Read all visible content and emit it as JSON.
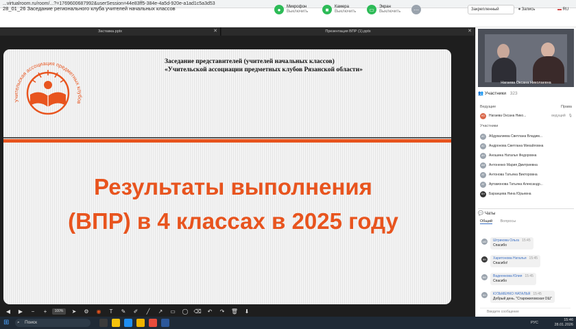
{
  "browser": {
    "url": "...virtualroom.ru/room/...?=1769600687992&userSession=44e83ff5-384e-4a5d-920e-a1ad1c5a3d53"
  },
  "meeting": {
    "title": "28_01_26 Заседание регионального клуба учителей начальных классов"
  },
  "controls": [
    {
      "label": "Микрофон",
      "sub": "Выключить"
    },
    {
      "label": "Камера",
      "sub": "Выключить"
    },
    {
      "label": "Экран",
      "sub": "Выключить"
    }
  ],
  "top_right": {
    "language_select": "Закрепленный",
    "record": "Запись",
    "lang": "RU"
  },
  "stage_tabs": [
    {
      "label": "Заставка.pptx"
    },
    {
      "label": "Презентация ВПР (1).pptx"
    }
  ],
  "slide": {
    "header_line1": "Заседание представителей (учителей начальных классов)",
    "header_line2": "«Учительской ассоциации предметных клубов Рязанской области»",
    "title_line1": "Результаты выполнения",
    "title_line2": "(ВПР) в 4 классах в 2025 году",
    "logo_arc_text": "Учительская ассоциация предметных клубов Рязанской области"
  },
  "toolbar": {
    "zoom": "100%"
  },
  "taskbar": {
    "search_placeholder": "Поиск",
    "lang": "РУС",
    "time": "15:46",
    "date": "28.01.2026"
  },
  "video": {
    "name": "Нагаева Оксана Николаевна"
  },
  "participants": {
    "title": "Участники",
    "count": "323",
    "leaders_label": "Ведущие",
    "rights_label": "Права",
    "leader": {
      "initials": "НО",
      "name": "Нагаева Оксана Нико...",
      "role": "ведущий"
    },
    "members_label": "Участники",
    "members": [
      {
        "initials": "АС",
        "name": "Абдувалиева Светлана Владим..."
      },
      {
        "initials": "АС",
        "name": "Андронова Светлана Михайловна"
      },
      {
        "initials": "АН",
        "name": "Аношина Наталья Федоровна"
      },
      {
        "initials": "АМ",
        "name": "Антоненко Мария Дмитриевна"
      },
      {
        "initials": "АТ",
        "name": "Антонова Татьяна Викторовна"
      },
      {
        "initials": "АТ",
        "name": "Артамонова Татьяна Александр..."
      },
      {
        "initials": "БН",
        "name": "Баранцева Нина Юрьевна"
      }
    ]
  },
  "chat": {
    "title": "Чаты",
    "tabs": [
      "Общий",
      "Вопросы"
    ],
    "messages": [
      {
        "initials": "ШО",
        "author": "Штрикова Ольга",
        "time": "15:45",
        "text": "Спасибо"
      },
      {
        "initials": "КН",
        "author": "Харитонова Наталья",
        "time": "15:45",
        "text": "Спасибо!"
      },
      {
        "initials": "ВЮ",
        "author": "Вадеенкова Юлия",
        "time": "15:45",
        "text": "Спасибо"
      },
      {
        "initials": "КН",
        "author": "КУЗЬМЕНКО НАТАЛЬЯ",
        "time": "15:45",
        "text": "Добрый день. \"Старожиловская ОШ\""
      }
    ],
    "input_placeholder": "Введите сообщение"
  },
  "colors": {
    "accent": "#e8541e",
    "dark_bg": "#1e1e1e",
    "taskbar": "#1f2a36",
    "link": "#3a6fc4"
  }
}
